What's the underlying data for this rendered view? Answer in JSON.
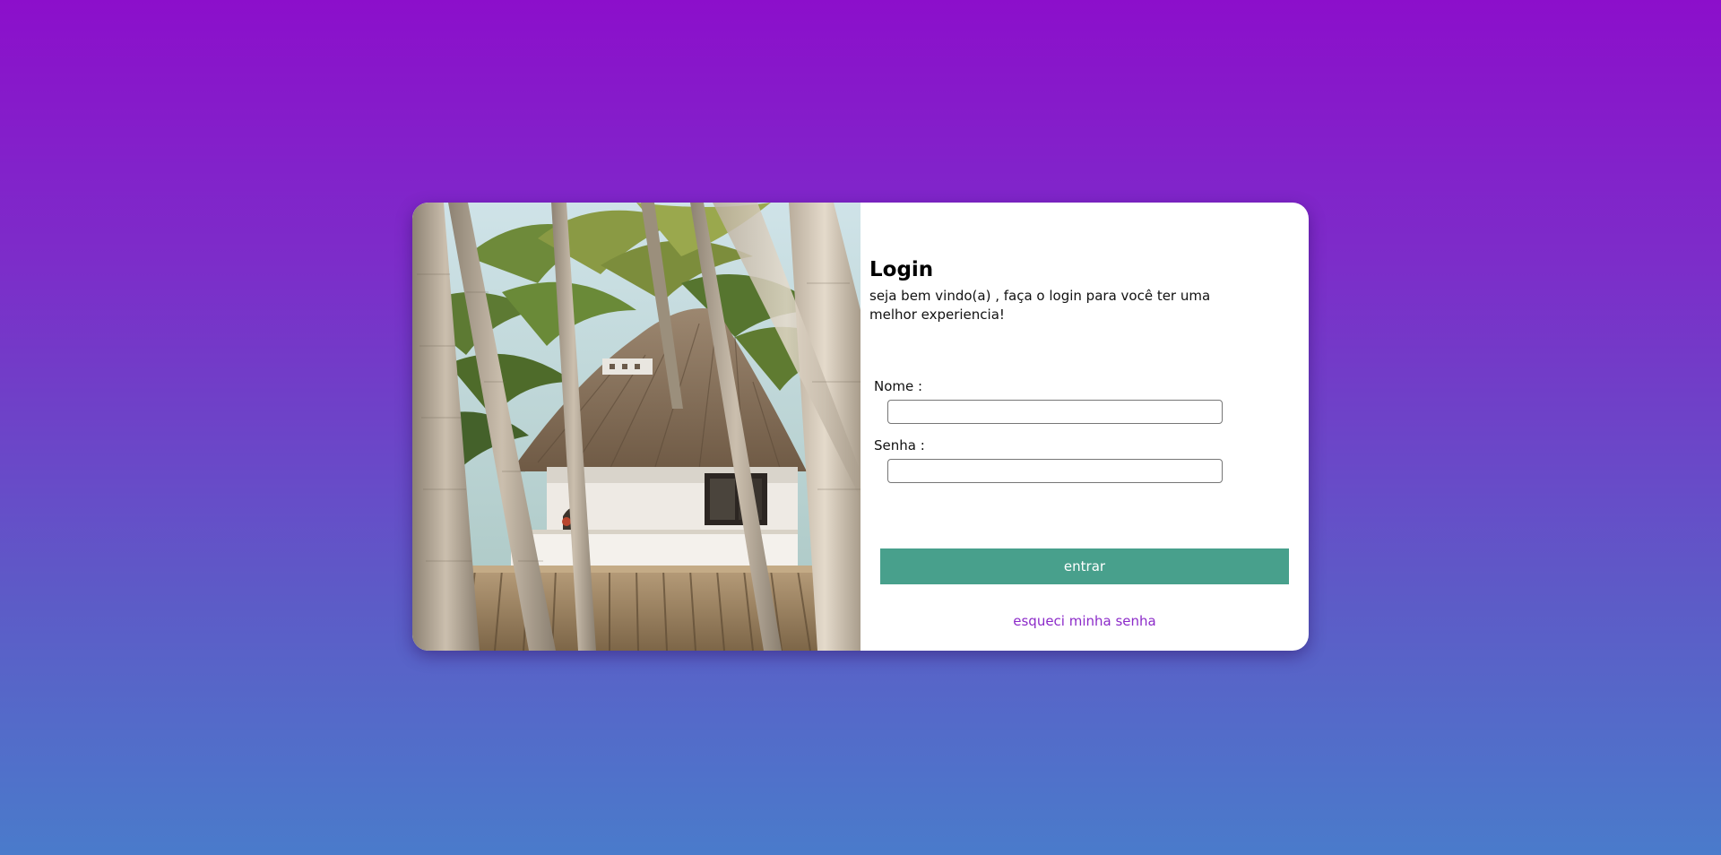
{
  "login": {
    "title": "Login",
    "subtitle": "seja bem vindo(a) , faça o login para você ter uma melhor experiencia!",
    "fields": [
      {
        "label": "Nome :",
        "value": "",
        "placeholder": ""
      },
      {
        "label": "Senha :",
        "value": "",
        "placeholder": ""
      }
    ],
    "submit_label": "entrar",
    "forgot_label": "esqueci minha senha"
  },
  "colors": {
    "background_top": "#8c0fcb",
    "background_bottom": "#4a7bcb",
    "button": "#48a08c",
    "link": "#8c2bc9"
  },
  "image": {
    "subject": "thatched-roof beach hut among palm trees"
  }
}
